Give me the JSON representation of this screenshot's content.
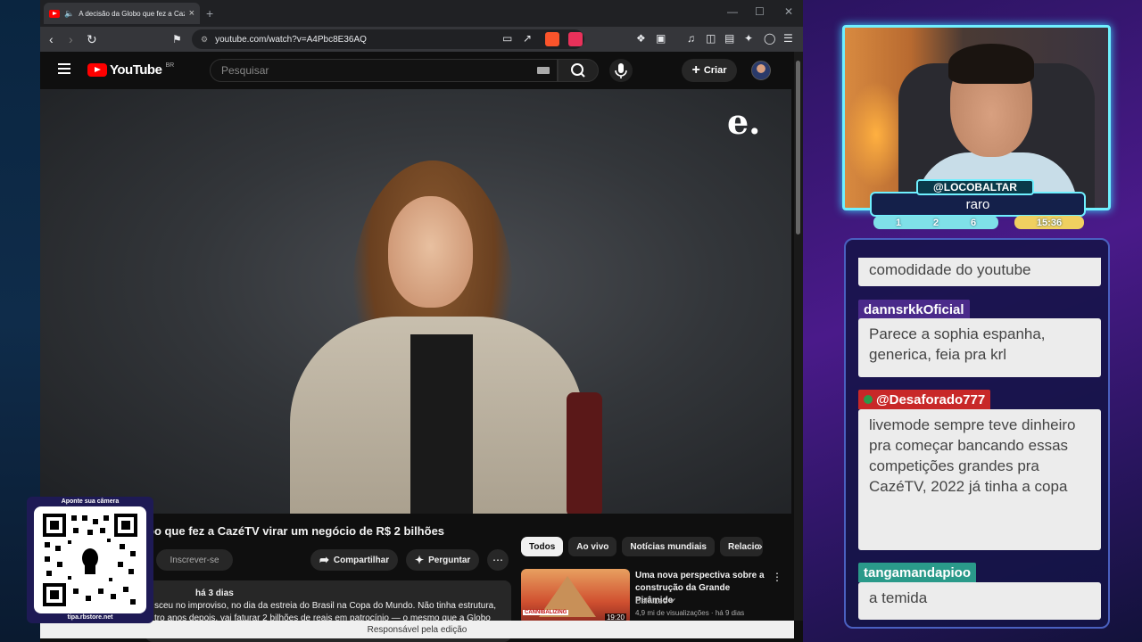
{
  "browser": {
    "tab_title": "A decisão da Globo que fez a Cazé…",
    "url": "youtube.com/watch?v=A4Pbc8E36AQ"
  },
  "youtube": {
    "logo_text": "YouTube",
    "region": "BR",
    "search_placeholder": "Pesquisar",
    "create_label": "Criar",
    "player_logo": "e.",
    "video_title": "bo que fez a CazéTV virar um negócio de R$ 2 bilhões",
    "subscribe_label": "Inscrever-se",
    "share_label": "Compartilhar",
    "ask_label": "Perguntar",
    "description": {
      "date": "há 3 dias",
      "line1": "sceu no improviso, no dia da estreia do Brasil na Copa do Mundo. Não tinha estrutura,",
      "line2": "tro anos depois, vai faturar 2 bilhões de reais em patrocínio — o mesmo que a Globo"
    },
    "chips": [
      "Todos",
      "Ao vivo",
      "Notícias mundiais",
      "Relacio"
    ],
    "recommendation": {
      "title": "Uma nova perspectiva sobre a construção da Grande Pirâmide",
      "channel": "DamiLee",
      "meta": "4,9 mi de visualizações · há 9 dias",
      "duration": "19:20",
      "thumb_label": "CANNIBALIZING"
    },
    "status_bar": "Responsável pela edição"
  },
  "overlay": {
    "qr_top": "Aponte sua câmera",
    "qr_bottom": "tipa.rbstore.net",
    "streamer_handle": "@LOCOBALTAR",
    "status_text": "raro",
    "stats": [
      "1",
      "2",
      "6"
    ],
    "time": "15:36"
  },
  "chat": {
    "messages": [
      {
        "user": "",
        "text": "comodidade do youtube",
        "color": "#ececec"
      },
      {
        "user": "dannsrkkOficial",
        "text": "Parece a sophia espanha, generica, feia pra krl",
        "color": "#4a2a8a"
      },
      {
        "user": "@Desaforado777",
        "text": "livemode sempre teve dinheiro pra começar bancando essas competições grandes pra CazéTV, 2022 já tinha a copa",
        "color": "#c82828"
      },
      {
        "user": "tangamandapioo",
        "text": "a temida",
        "color": "#2a9a8a"
      }
    ]
  }
}
